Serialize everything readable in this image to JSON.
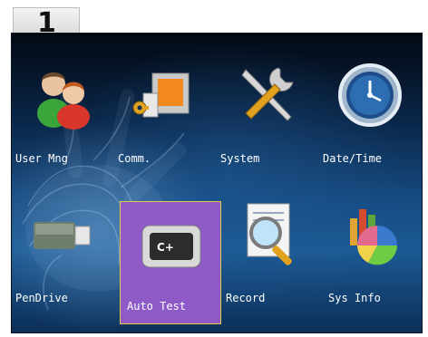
{
  "step_number": "1",
  "menu": {
    "items": [
      {
        "label": "User Mng"
      },
      {
        "label": "Comm."
      },
      {
        "label": "System"
      },
      {
        "label": "Date/Time"
      },
      {
        "label": "PenDrive"
      },
      {
        "label": "Auto Test"
      },
      {
        "label": "Record"
      },
      {
        "label": "Sys Info"
      }
    ],
    "selected": "Auto Test"
  },
  "colors": {
    "background_top": "#030913",
    "background_mid": "#154a80",
    "selection_fill": "#8e5ac8",
    "selection_border": "#e8c74a",
    "label_text": "#ffffff"
  },
  "icons": [
    "users-icon",
    "communication-icon",
    "tools-icon",
    "clock-icon",
    "usb-drive-icon",
    "chip-test-icon",
    "magnifier-document-icon",
    "chart-icon"
  ]
}
